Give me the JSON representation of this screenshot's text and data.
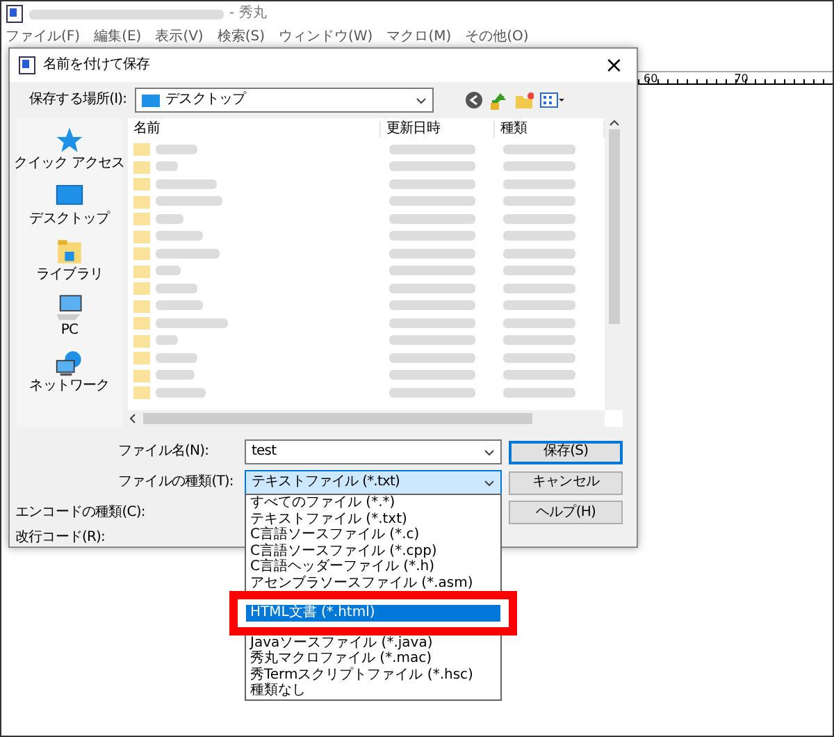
{
  "app": {
    "title": "- 秀丸",
    "menu": [
      "ファイル(F)",
      "編集(E)",
      "表示(V)",
      "検索(S)",
      "ウィンドウ(W)",
      "マクロ(M)",
      "その他(O)"
    ],
    "ruler": [
      "60",
      "70"
    ]
  },
  "dialog": {
    "title": "名前を付けて保存",
    "close": "×",
    "location": {
      "label": "保存する場所(I):",
      "value": "デスクトップ"
    },
    "places": [
      {
        "label": "クイック アクセス",
        "kind": "star"
      },
      {
        "label": "デスクトップ",
        "kind": "desktop"
      },
      {
        "label": "ライブラリ",
        "kind": "library"
      },
      {
        "label": "PC",
        "kind": "pc"
      },
      {
        "label": "ネットワーク",
        "kind": "network"
      }
    ],
    "columns": [
      "名前",
      "更新日時",
      "種類"
    ],
    "file_rows": [
      {
        "kind": "folder"
      },
      {
        "kind": "folder"
      },
      {
        "kind": "folder"
      },
      {
        "kind": "folder"
      },
      {
        "kind": "folder"
      },
      {
        "kind": "folder"
      },
      {
        "kind": "folder"
      },
      {
        "kind": "folder"
      },
      {
        "kind": "folder"
      },
      {
        "kind": "folder"
      },
      {
        "kind": "folder"
      },
      {
        "kind": "folder"
      },
      {
        "kind": "folder"
      },
      {
        "kind": "folder"
      },
      {
        "kind": "folder"
      }
    ],
    "file_name": {
      "label": "ファイル名(N):",
      "value": "test"
    },
    "file_type": {
      "label": "ファイルの種類(T):",
      "value": "テキストファイル (*.txt)",
      "expanded": true
    },
    "encoding": {
      "label": "エンコードの種類(C):"
    },
    "newline": {
      "label": "改行コード(R):"
    },
    "buttons": [
      {
        "label": "保存(S)",
        "default": true
      },
      {
        "label": "キャンセル",
        "default": false
      },
      {
        "label": "ヘルプ(H)",
        "default": false
      }
    ],
    "type_options": [
      {
        "kind": "option",
        "label": "すべてのファイル (*.*)",
        "selected": false
      },
      {
        "kind": "option",
        "label": "テキストファイル (*.txt)",
        "selected": false
      },
      {
        "kind": "option",
        "label": "C言語ソースファイル (*.c)",
        "selected": false
      },
      {
        "kind": "option",
        "label": "C言語ソースファイル (*.cpp)",
        "selected": false
      },
      {
        "kind": "option",
        "label": "C言語ヘッダーファイル (*.h)",
        "selected": false
      },
      {
        "kind": "option",
        "label": "アセンブラソースファイル (*.asm)",
        "selected": false
      },
      {
        "kind": "highlight-frame",
        "children": [
          {
            "label": "HTML文書 (*.html)",
            "selected": true
          }
        ]
      },
      {
        "kind": "option",
        "label": "Javaソースファイル (*.java)",
        "selected": false
      },
      {
        "kind": "option",
        "label": "秀丸マクロファイル (*.mac)",
        "selected": false
      },
      {
        "kind": "option",
        "label": "秀Termスクリプトファイル (*.hsc)",
        "selected": false
      },
      {
        "kind": "option",
        "label": "種類なし",
        "selected": false
      }
    ]
  }
}
